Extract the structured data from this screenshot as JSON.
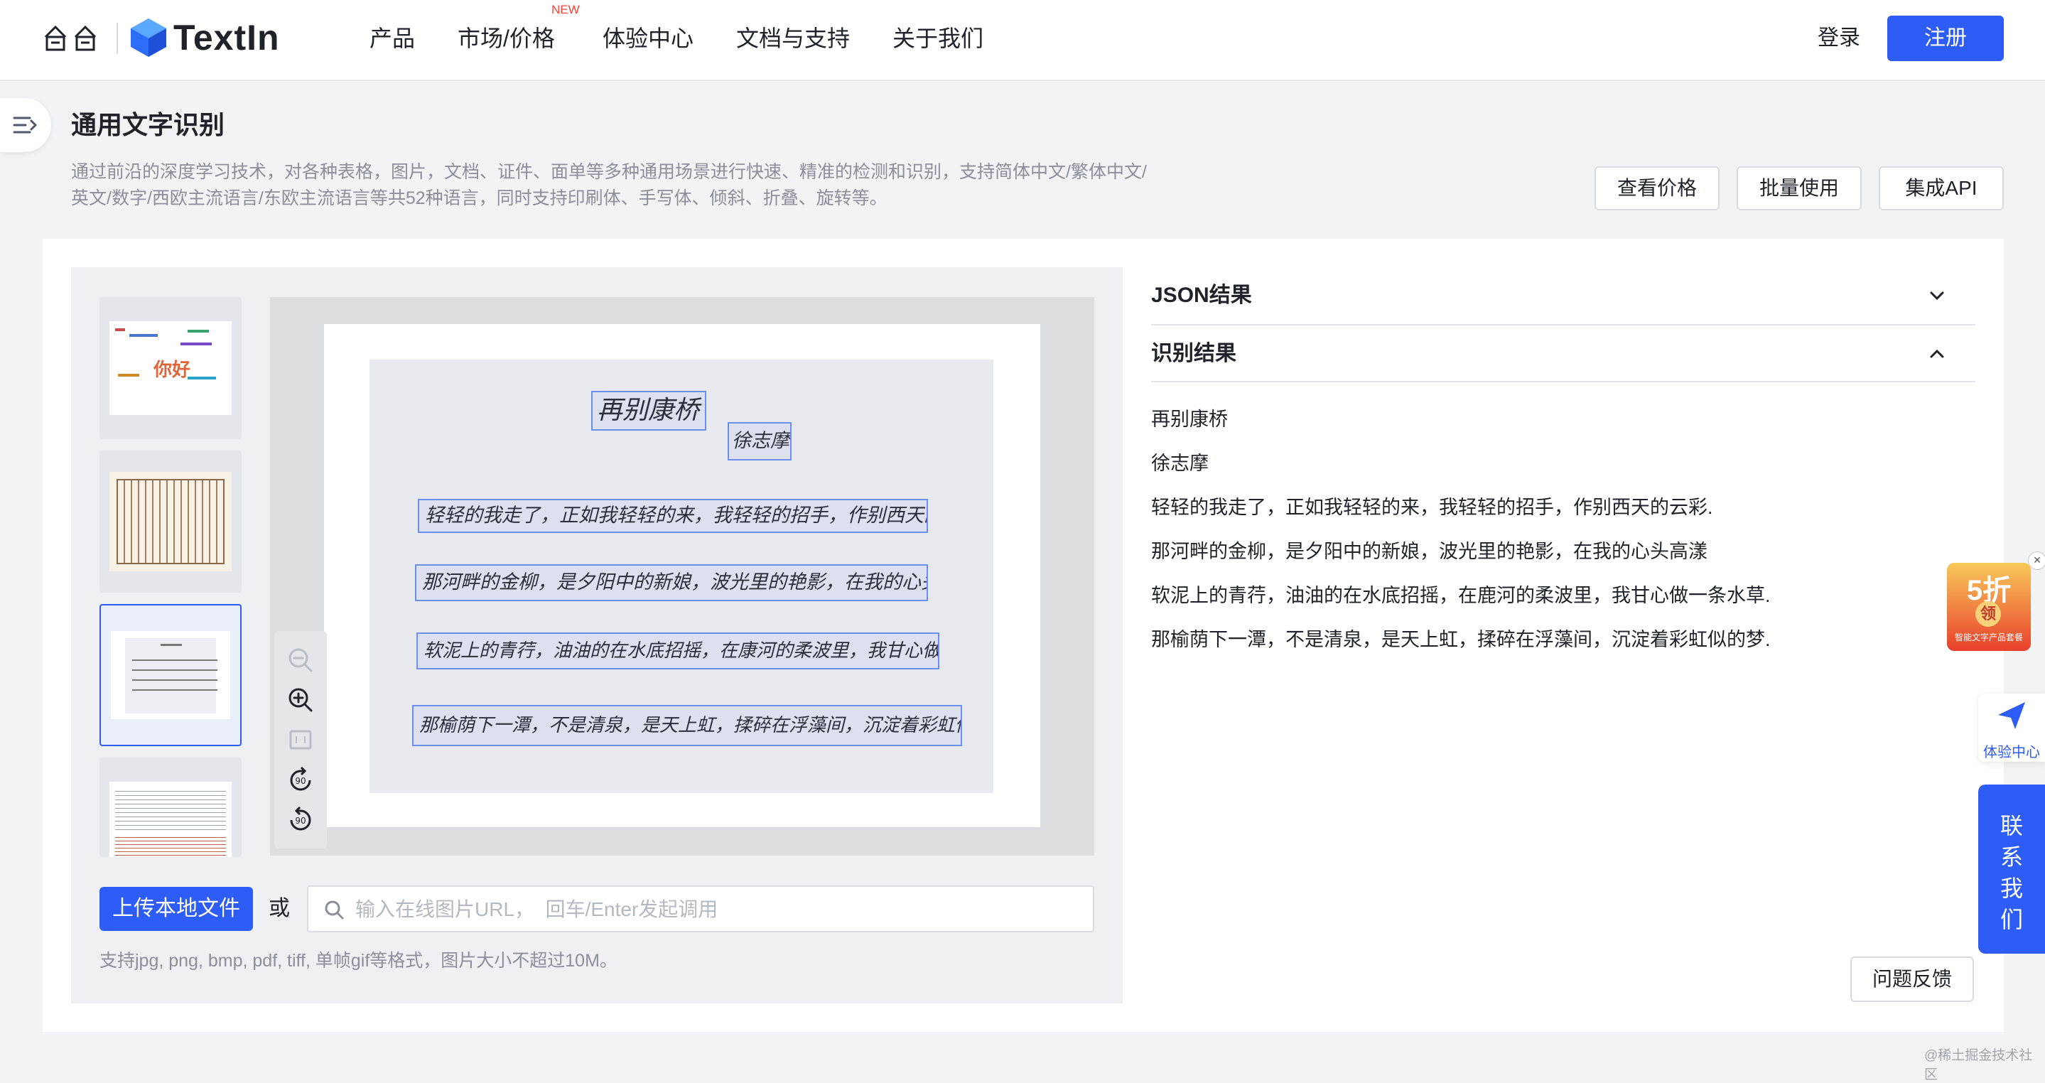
{
  "nav": {
    "brand": "TextIn",
    "items": [
      "产品",
      "市场/价格",
      "体验中心",
      "文档与支持",
      "关于我们"
    ],
    "new_badge": "NEW",
    "login": "登录",
    "signup": "注册"
  },
  "header": {
    "title": "通用文字识别",
    "description": "通过前沿的深度学习技术，对各种表格，图片，文档、证件、面单等多种通用场景进行快速、精准的检测和识别，支持简体中文/繁体中文/英文/数字/西欧主流语言/东欧主流语言等共52种语言，同时支持印刷体、手写体、倾斜、折叠、旋转等。",
    "buttons": [
      "查看价格",
      "批量使用",
      "集成API"
    ]
  },
  "sample_thumbs": [
    {
      "name": "word-cloud",
      "selected": false,
      "word": "你好"
    },
    {
      "name": "ancient-book",
      "selected": false
    },
    {
      "name": "handwritten-poem",
      "selected": true
    },
    {
      "name": "english-document",
      "selected": false
    }
  ],
  "viewer": {
    "handwritten_lines": [
      "再别康桥",
      "徐志摩",
      "轻轻的我走了，正如我轻轻的来，我轻轻的招手，作别西天的云彩",
      "那河畔的金柳，是夕阳中的新娘，波光里的艳影，在我的心头荡漾",
      "软泥上的青荇，油油的在水底招摇，在康河的柔波里，我甘心做一条水草",
      "那榆荫下一潭，不是清泉，是天上虹，揉碎在浮藻间，沉淀着彩虹似的梦"
    ],
    "zoom_tools": [
      "zoom-out-icon",
      "zoom-in-icon",
      "fit-icon",
      "rotate-left-icon",
      "rotate-right-icon"
    ]
  },
  "upload": {
    "button": "上传本地文件",
    "or": "或",
    "url_placeholder": "输入在线图片URL，  回车/Enter发起调用",
    "format_note": "支持jpg, png, bmp, pdf, tiff, 单帧gif等格式，图片大小不超过10M。"
  },
  "results": {
    "json_title": "JSON结果",
    "recognition_title": "识别结果",
    "lines": [
      "再别康桥",
      "徐志摩",
      "轻轻的我走了，正如我轻轻的来，我轻轻的招手，作别西天的云彩.",
      "那河畔的金柳，是夕阳中的新娘，波光里的艳影，在我的心头高漾",
      "软泥上的青荇，油油的在水底招摇，在鹿河的柔波里，我甘心做一条水草.",
      "那榆荫下一潭，不是清泉，是天上虹，揉碎在浮藻间，沉淀着彩虹似的梦."
    ],
    "feedback": "问题反馈"
  },
  "floating": {
    "promo_big": "5折",
    "promo_small": "领",
    "promo_caption": "智能文字产品套餐",
    "experience": "体验中心",
    "contact": "联系我们"
  },
  "watermark": "@稀土掘金技术社区",
  "colors": {
    "accent": "#2d5cf6",
    "background": "#f2f3f5"
  }
}
